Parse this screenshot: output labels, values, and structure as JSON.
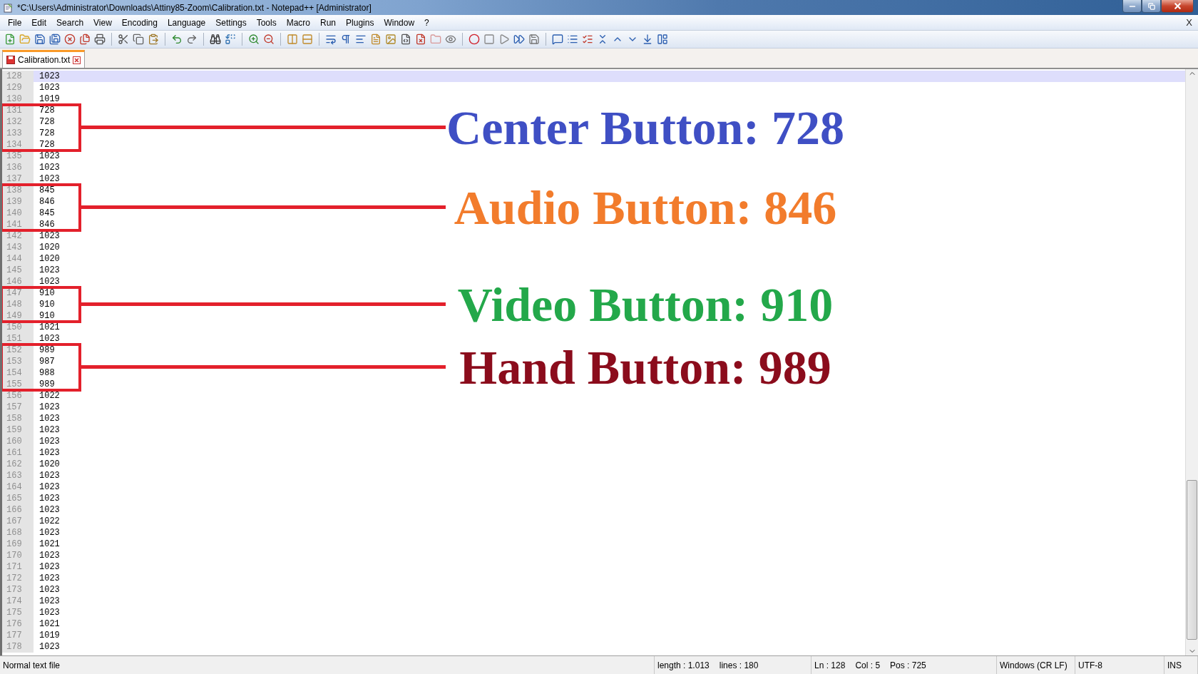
{
  "window": {
    "title": "*C:\\Users\\Administrator\\Downloads\\Attiny85-Zoom\\Calibration.txt - Notepad++ [Administrator]"
  },
  "menu": [
    "File",
    "Edit",
    "Search",
    "View",
    "Encoding",
    "Language",
    "Settings",
    "Tools",
    "Macro",
    "Run",
    "Plugins",
    "Window",
    "?"
  ],
  "menu_close": "X",
  "tabs": [
    {
      "label": "Calibration.txt",
      "selected": true
    }
  ],
  "editor": {
    "lines": [
      {
        "kind": "line",
        "number": "128",
        "text": "1023",
        "current": true
      },
      {
        "kind": "line",
        "number": "129",
        "text": "1023",
        "current": false
      },
      {
        "kind": "line",
        "number": "130",
        "text": "1019",
        "current": false
      },
      {
        "kind": "marked",
        "label": "Center Button: 728",
        "color": "#3f4fc4",
        "lines": [
          {
            "number": "131",
            "text": "728",
            "current": false
          },
          {
            "number": "132",
            "text": "728",
            "current": false
          },
          {
            "number": "133",
            "text": "728",
            "current": false
          },
          {
            "number": "134",
            "text": "728",
            "current": false
          }
        ]
      },
      {
        "kind": "line",
        "number": "135",
        "text": "1023",
        "current": false
      },
      {
        "kind": "line",
        "number": "136",
        "text": "1023",
        "current": false
      },
      {
        "kind": "line",
        "number": "137",
        "text": "1023",
        "current": false
      },
      {
        "kind": "marked",
        "label": "Audio Button: 846",
        "color": "#f27c2c",
        "lines": [
          {
            "number": "138",
            "text": "845",
            "current": false
          },
          {
            "number": "139",
            "text": "846",
            "current": false
          },
          {
            "number": "140",
            "text": "845",
            "current": false
          },
          {
            "number": "141",
            "text": "846",
            "current": false
          }
        ]
      },
      {
        "kind": "line",
        "number": "142",
        "text": "1023",
        "current": false
      },
      {
        "kind": "line",
        "number": "143",
        "text": "1020",
        "current": false
      },
      {
        "kind": "line",
        "number": "144",
        "text": "1020",
        "current": false
      },
      {
        "kind": "line",
        "number": "145",
        "text": "1023",
        "current": false
      },
      {
        "kind": "line",
        "number": "146",
        "text": "1023",
        "current": false
      },
      {
        "kind": "marked",
        "label": "Video Button: 910",
        "color": "#23a84a",
        "lines": [
          {
            "number": "147",
            "text": "910",
            "current": false
          },
          {
            "number": "148",
            "text": "910",
            "current": false
          },
          {
            "number": "149",
            "text": "910",
            "current": false
          }
        ]
      },
      {
        "kind": "line",
        "number": "150",
        "text": "1021",
        "current": false
      },
      {
        "kind": "line",
        "number": "151",
        "text": "1023",
        "current": false
      },
      {
        "kind": "marked",
        "label": "Hand Button: 989",
        "color": "#8b0c1c",
        "lines": [
          {
            "number": "152",
            "text": "989",
            "current": false
          },
          {
            "number": "153",
            "text": "987",
            "current": false
          },
          {
            "number": "154",
            "text": "988",
            "current": false
          },
          {
            "number": "155",
            "text": "989",
            "current": false
          }
        ]
      },
      {
        "kind": "line",
        "number": "156",
        "text": "1022",
        "current": false
      },
      {
        "kind": "line",
        "number": "157",
        "text": "1023",
        "current": false
      },
      {
        "kind": "line",
        "number": "158",
        "text": "1023",
        "current": false
      },
      {
        "kind": "line",
        "number": "159",
        "text": "1023",
        "current": false
      },
      {
        "kind": "line",
        "number": "160",
        "text": "1023",
        "current": false
      },
      {
        "kind": "line",
        "number": "161",
        "text": "1023",
        "current": false
      },
      {
        "kind": "line",
        "number": "162",
        "text": "1020",
        "current": false
      },
      {
        "kind": "line",
        "number": "163",
        "text": "1023",
        "current": false
      },
      {
        "kind": "line",
        "number": "164",
        "text": "1023",
        "current": false
      },
      {
        "kind": "line",
        "number": "165",
        "text": "1023",
        "current": false
      },
      {
        "kind": "line",
        "number": "166",
        "text": "1023",
        "current": false
      },
      {
        "kind": "line",
        "number": "167",
        "text": "1022",
        "current": false
      },
      {
        "kind": "line",
        "number": "168",
        "text": "1023",
        "current": false
      },
      {
        "kind": "line",
        "number": "169",
        "text": "1021",
        "current": false
      },
      {
        "kind": "line",
        "number": "170",
        "text": "1023",
        "current": false
      },
      {
        "kind": "line",
        "number": "171",
        "text": "1023",
        "current": false
      },
      {
        "kind": "line",
        "number": "172",
        "text": "1023",
        "current": false
      },
      {
        "kind": "line",
        "number": "173",
        "text": "1023",
        "current": false
      },
      {
        "kind": "line",
        "number": "174",
        "text": "1023",
        "current": false
      },
      {
        "kind": "line",
        "number": "175",
        "text": "1023",
        "current": false
      },
      {
        "kind": "line",
        "number": "176",
        "text": "1021",
        "current": false
      },
      {
        "kind": "line",
        "number": "177",
        "text": "1019",
        "current": false
      },
      {
        "kind": "line",
        "number": "178",
        "text": "1023",
        "current": false
      }
    ]
  },
  "status_bar": [
    {
      "items": [
        "Normal text file"
      ]
    },
    {
      "items": [
        "length : 1.013",
        "lines : 180"
      ]
    },
    {
      "items": [
        "Ln : 128",
        "Col : 5",
        "Pos : 725"
      ]
    },
    {
      "items": [
        "Windows (CR LF)"
      ]
    },
    {
      "items": [
        "UTF-8"
      ]
    },
    {
      "items": [
        "INS"
      ]
    }
  ]
}
